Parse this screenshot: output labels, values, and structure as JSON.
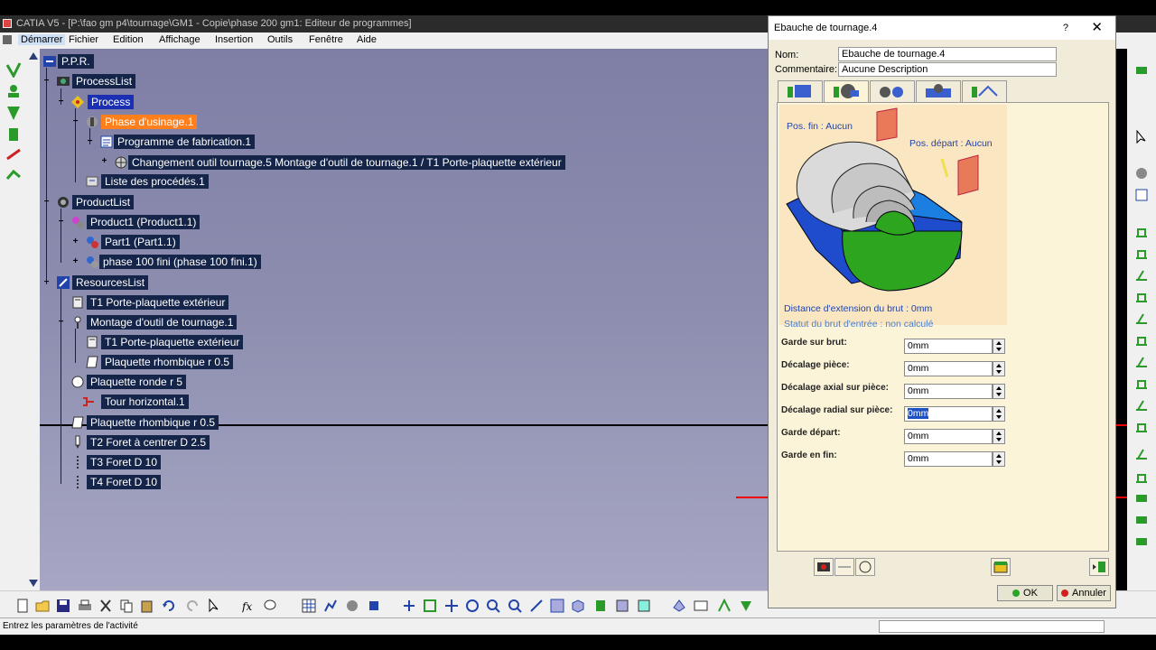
{
  "window": {
    "title": "CATIA V5 - [P:\\fao gm p4\\tournage\\GM1 - Copie\\phase 200 gm1: Editeur de programmes]"
  },
  "menu": [
    {
      "label": "Démarrer",
      "name": "menu-demarrer"
    },
    {
      "label": "Fichier",
      "name": "menu-fichier"
    },
    {
      "label": "Edition",
      "name": "menu-edition"
    },
    {
      "label": "Affichage",
      "name": "menu-affichage"
    },
    {
      "label": "Insertion",
      "name": "menu-insertion"
    },
    {
      "label": "Outils",
      "name": "menu-outils"
    },
    {
      "label": "Fenêtre",
      "name": "menu-fenetre"
    },
    {
      "label": "Aide",
      "name": "menu-aide"
    }
  ],
  "tree": {
    "ppr": "P.P.R.",
    "processlist": "ProcessList",
    "process": "Process",
    "phase": "Phase d'usinage.1",
    "programme": "Programme de fabrication.1",
    "changement": "Changement outil tournage.5  Montage d'outil de tournage.1 / T1 Porte-plaquette extérieur",
    "liste": "Liste des procédés.1",
    "productlist": "ProductList",
    "product1": "Product1 (Product1.1)",
    "part1": "Part1 (Part1.1)",
    "phase100": "phase 100 fini (phase 100 fini.1)",
    "resourceslist": "ResourcesList",
    "t1a": "T1 Porte-plaquette extérieur",
    "montage": "Montage d'outil de tournage.1",
    "t1b": "T1 Porte-plaquette extérieur",
    "plaquette1": "Plaquette rhombique r 0.5",
    "ronde": "Plaquette ronde r 5",
    "tour": "Tour horizontal.1",
    "plaquette2": "Plaquette rhombique r 0.5",
    "t2": "T2 Foret à centrer D 2.5",
    "t3": "T3 Foret D 10",
    "t4": "T4 Foret D 10"
  },
  "status": {
    "text": "Entrez les paramètres de l'activité"
  },
  "dialog": {
    "title": "Ebauche de tournage.4",
    "help": "?",
    "close": "✕",
    "nom_label": "Nom:",
    "nom_value": "Ebauche de tournage.4",
    "commentaire_label": "Commentaire:",
    "commentaire_value": "Aucune Description",
    "pos_fin": "Pos. fin : Aucun",
    "pos_depart": "Pos. départ : Aucun",
    "distance": "Distance d'extension du brut : 0mm",
    "statut": "Statut du brut d'entrée : non calculé",
    "params": [
      {
        "label": "Garde sur brut:",
        "value": "0mm"
      },
      {
        "label": "Décalage pièce:",
        "value": "0mm"
      },
      {
        "label": "Décalage axial sur pièce:",
        "value": "0mm"
      },
      {
        "label": "Décalage radial sur pièce:",
        "value": "0mm"
      },
      {
        "label": "Garde départ:",
        "value": "0mm"
      },
      {
        "label": "Garde en fin:",
        "value": "0mm"
      }
    ],
    "ok": "OK",
    "cancel": "Annuler"
  },
  "colors": {
    "tree_node_bg": "#152449",
    "selected": "#ff7f1c",
    "ok_dot": "#2aa52a",
    "cancel_dot": "#d02020"
  }
}
